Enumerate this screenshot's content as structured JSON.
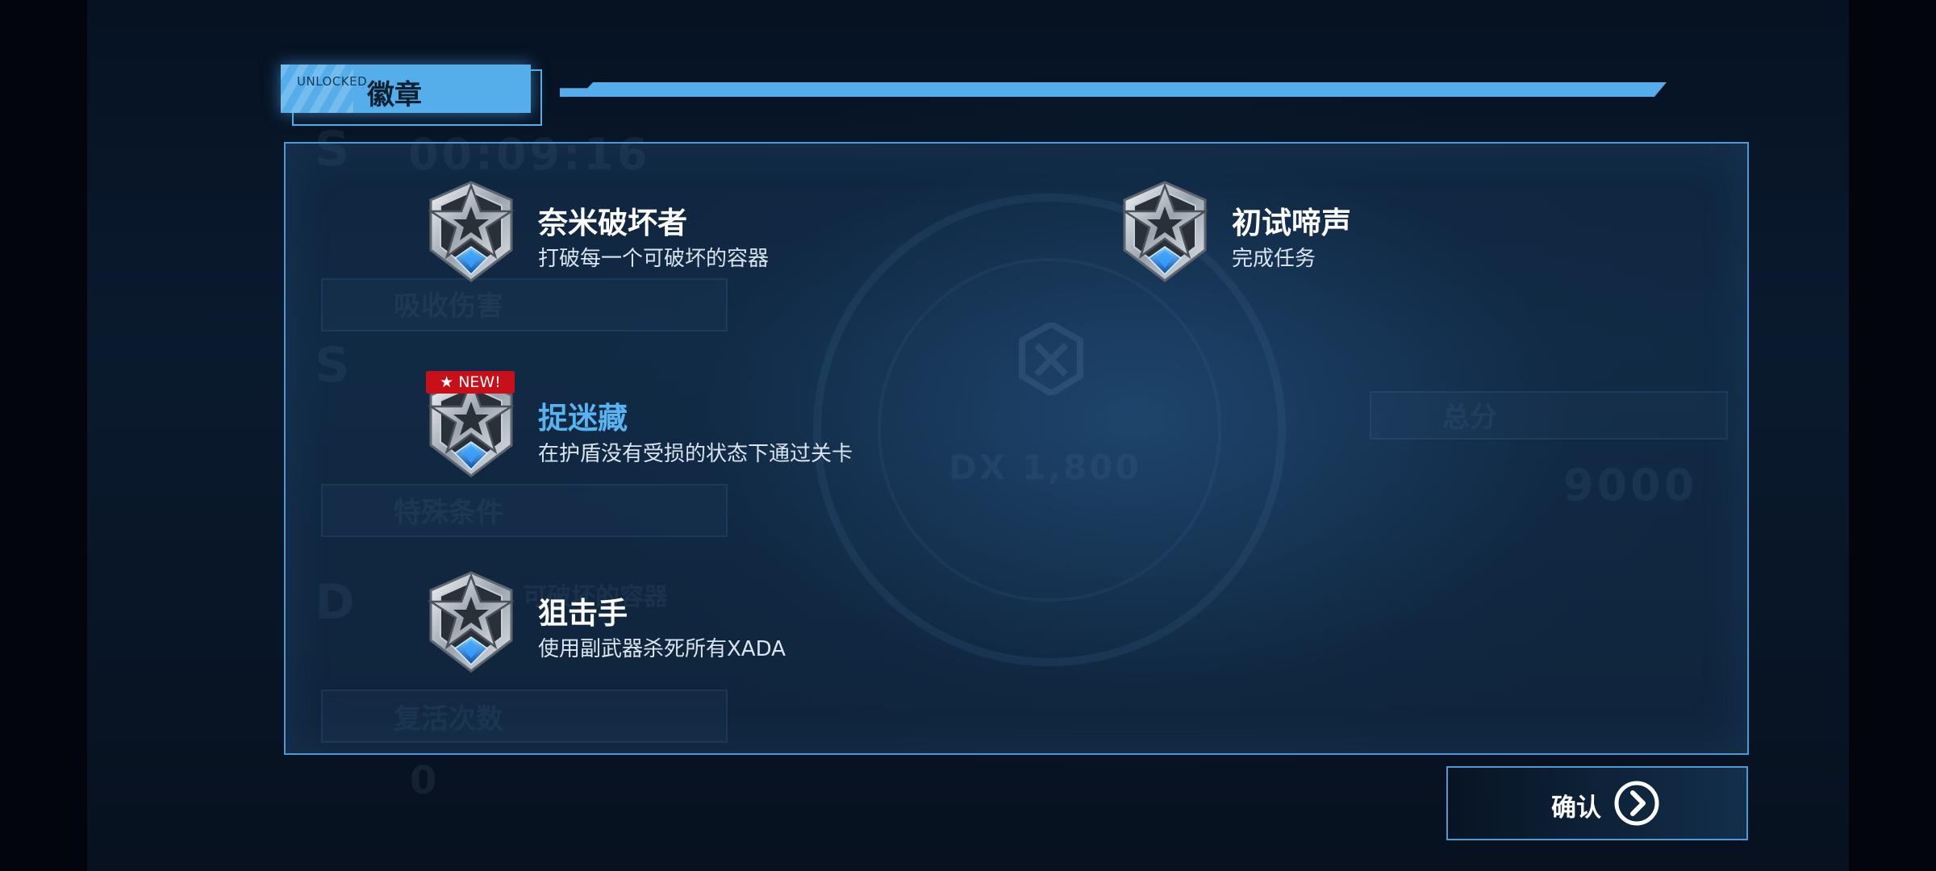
{
  "header": {
    "unlocked_label": "UNLOCKED",
    "title": "徽章"
  },
  "background_ghost": {
    "time": "00:09:16",
    "rank1": "S",
    "label1": "吸收伤害",
    "rank2": "S",
    "label2": "特殊条件",
    "rank3": "D",
    "label3": "可破坏的容器",
    "label4": "复活次数",
    "zero": "0",
    "dx": "DX 1,800",
    "total_label": "总分",
    "total": "9000"
  },
  "badges": [
    {
      "title": "奈米破坏者",
      "description": "打破每一个可破坏的容器",
      "is_new": false,
      "icon": "star-badge-icon"
    },
    {
      "title": "初试啼声",
      "description": "完成任务",
      "is_new": false,
      "icon": "star-badge-icon"
    },
    {
      "title": "捉迷藏",
      "description": "在护盾没有受损的状态下通过关卡",
      "is_new": true,
      "new_label": "★ NEW!",
      "icon": "star-badge-icon"
    },
    {
      "title": "狙击手",
      "description": "使用副武器杀死所有XADA",
      "is_new": false,
      "icon": "star-badge-icon"
    }
  ],
  "confirm": {
    "label": "确认",
    "icon": "chevron-right-circle-icon"
  },
  "colors": {
    "accent": "#55aeea",
    "panel_border": "#4f98d8",
    "highlight_title": "#58b4f0",
    "new_tag": "#c8101b"
  }
}
